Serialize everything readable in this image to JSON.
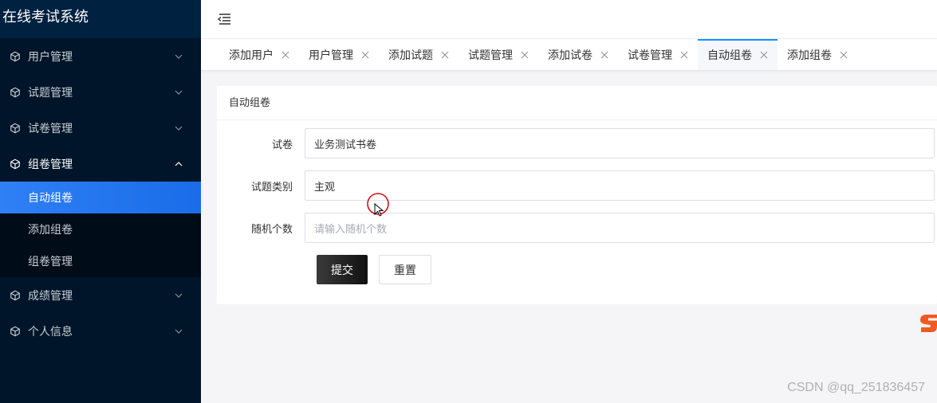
{
  "app": {
    "title": "在线考试系统"
  },
  "sidebar": {
    "menus": [
      {
        "label": "用户管理",
        "icon": "cube-icon",
        "expanded": false
      },
      {
        "label": "试题管理",
        "icon": "cube-icon",
        "expanded": false
      },
      {
        "label": "试卷管理",
        "icon": "cube-icon",
        "expanded": false
      },
      {
        "label": "组卷管理",
        "icon": "cube-icon",
        "expanded": true,
        "children": [
          {
            "label": "自动组卷",
            "active": true
          },
          {
            "label": "添加组卷",
            "active": false
          },
          {
            "label": "组卷管理",
            "active": false
          }
        ]
      },
      {
        "label": "成绩管理",
        "icon": "cube-icon",
        "expanded": false
      },
      {
        "label": "个人信息",
        "icon": "cube-icon",
        "expanded": false
      }
    ]
  },
  "tabs": [
    {
      "label": "添加用户",
      "active": false
    },
    {
      "label": "用户管理",
      "active": false
    },
    {
      "label": "添加试题",
      "active": false
    },
    {
      "label": "试题管理",
      "active": false
    },
    {
      "label": "添加试卷",
      "active": false
    },
    {
      "label": "试卷管理",
      "active": false
    },
    {
      "label": "自动组卷",
      "active": true
    },
    {
      "label": "添加组卷",
      "active": false
    }
  ],
  "card": {
    "title": "自动组卷",
    "fields": {
      "paper": {
        "label": "试卷",
        "value": "业务测试书卷"
      },
      "category": {
        "label": "试题类别",
        "value": "主观"
      },
      "random_count": {
        "label": "随机个数",
        "placeholder": "请输入随机个数"
      }
    },
    "submit_label": "提交",
    "reset_label": "重置"
  },
  "watermark": "CSDN @qq_251836457",
  "colors": {
    "sidebar_bg": "#001529",
    "brand_bg": "#002140",
    "active_item": "#1a6ce8",
    "tab_active_bar": "#1890ff",
    "submit_bg": "#111111"
  }
}
